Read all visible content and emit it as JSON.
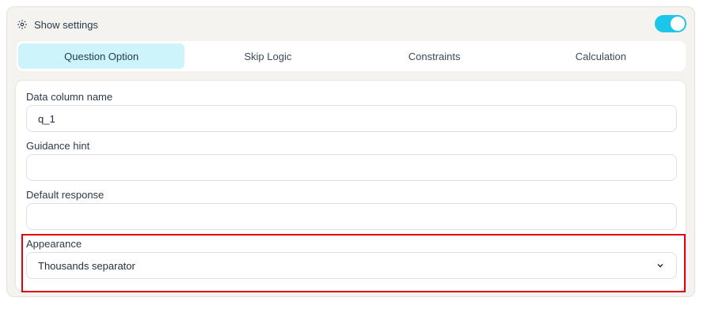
{
  "settings": {
    "title": "Show settings",
    "icon": "gear-icon",
    "toggle_on": true,
    "toggle_color": "#1cc6e8"
  },
  "tabs": [
    {
      "label": "Question Option",
      "active": true
    },
    {
      "label": "Skip Logic",
      "active": false
    },
    {
      "label": "Constraints",
      "active": false
    },
    {
      "label": "Calculation",
      "active": false
    }
  ],
  "form": {
    "data_column": {
      "label": "Data column name",
      "value": "q_1"
    },
    "guidance_hint": {
      "label": "Guidance hint",
      "value": ""
    },
    "default_response": {
      "label": "Default response",
      "value": ""
    },
    "appearance": {
      "label": "Appearance",
      "selected": "Thousands separator",
      "icon": "chevron-down-icon"
    }
  },
  "colors": {
    "active_tab": "#cdf4fb",
    "highlight_border": "#e0000f"
  }
}
